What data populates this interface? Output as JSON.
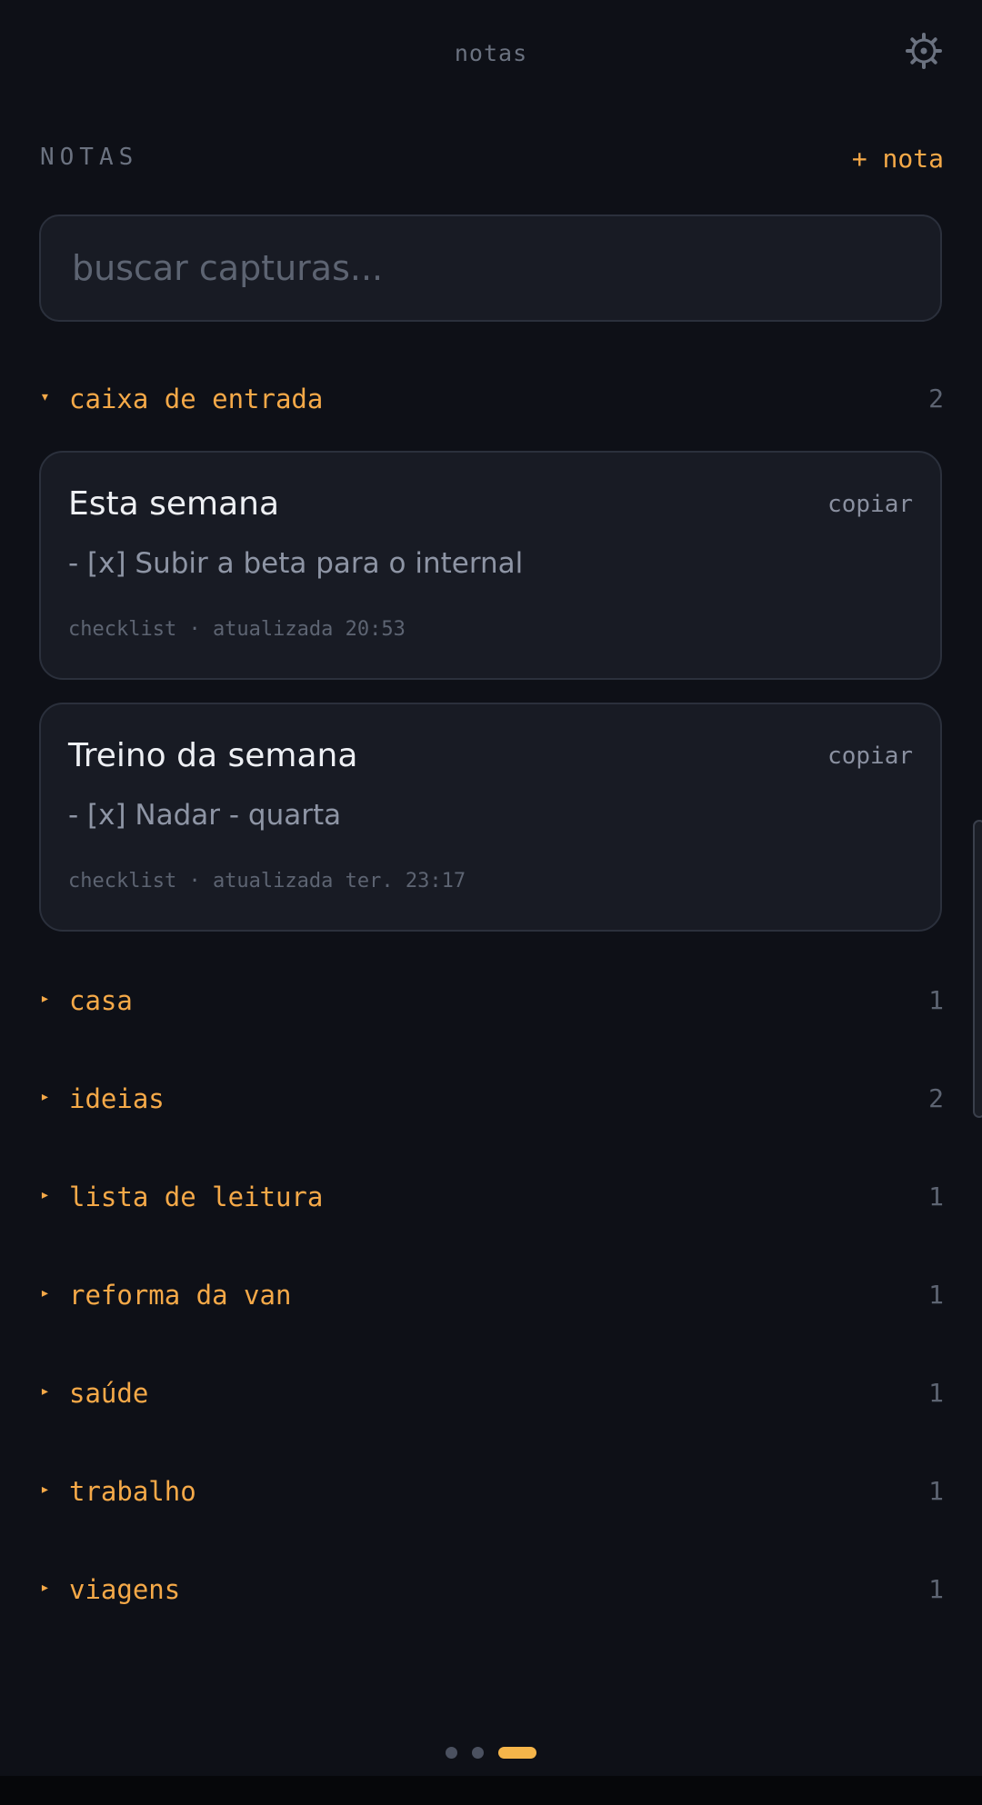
{
  "header": {
    "title": "notas",
    "settings_icon": "settings-icon"
  },
  "section": {
    "label": "NOTAS",
    "new_note_label": "+ nota"
  },
  "search": {
    "placeholder": "buscar capturas...",
    "value": ""
  },
  "folders": [
    {
      "arrow": "▾",
      "name": "caixa de entrada",
      "count": "2",
      "expanded": true
    },
    {
      "arrow": "▸",
      "name": "casa",
      "count": "1"
    },
    {
      "arrow": "▸",
      "name": "ideias",
      "count": "2"
    },
    {
      "arrow": "▸",
      "name": "lista de leitura",
      "count": "1"
    },
    {
      "arrow": "▸",
      "name": "reforma da van",
      "count": "1"
    },
    {
      "arrow": "▸",
      "name": "saúde",
      "count": "1"
    },
    {
      "arrow": "▸",
      "name": "trabalho",
      "count": "1"
    },
    {
      "arrow": "▸",
      "name": "viagens",
      "count": "1"
    }
  ],
  "notes": [
    {
      "title": "Esta semana",
      "copy_label": "copiar",
      "preview": "- [x] Subir a beta para o internal",
      "meta": "checklist · atualizada 20:53"
    },
    {
      "title": "Treino da semana",
      "copy_label": "copiar",
      "preview": "- [x] Nadar - quarta",
      "meta": "checklist · atualizada ter. 23:17"
    }
  ],
  "pager": {
    "pages": 3,
    "active_page": 3
  },
  "colors": {
    "background": "#0e1017",
    "card": "#181b24",
    "accent": "#f5a948",
    "muted": "#5d6472"
  }
}
